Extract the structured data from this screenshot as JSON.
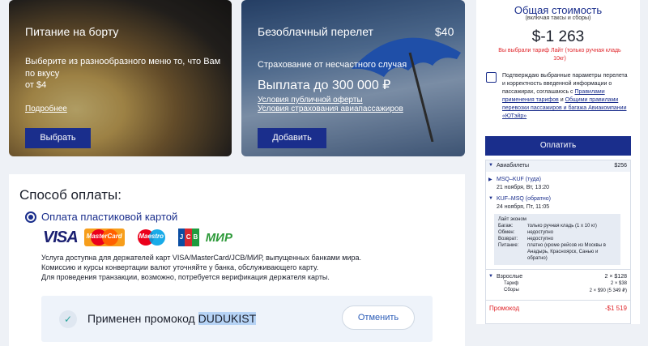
{
  "food_card": {
    "title": "Питание на борту",
    "text": "Выберите из разнообразного меню то, что Вам по вкусу",
    "price": "от $4",
    "link": "Подробнее",
    "button": "Выбрать"
  },
  "insurance_card": {
    "title": "Безоблачный перелет",
    "price": "$40",
    "subtitle": "Страхование от несчастного случая",
    "payout": "Выплата до 300 000 ₽",
    "link1": "Условия публичной оферты",
    "link2": "Условия страхования авиапассажиров",
    "button": "Добавить"
  },
  "payment": {
    "title": "Способ оплаты:",
    "option_label": "Оплата пластиковой картой",
    "card_brands": [
      "VISA",
      "MasterCard",
      "Maestro",
      "JCB",
      "МИР"
    ],
    "desc_line1": "Услуга доступна для держателей карт VISA/MasterCard/JCB/МИР, выпущенных банками мира.",
    "desc_line2": "Комиссию и курсы конвертации валют уточняйте у банка, обслуживающего карту.",
    "desc_line3": "Для проведения транзакции, возможно, потребуется верификация держателя карты.",
    "promo_prefix": "Применен промокод",
    "promo_code": "DUDUKIST",
    "cancel_button": "Отменить"
  },
  "summary": {
    "title": "Общая стоимость",
    "subtitle": "(включая таксы и сборы)",
    "total": "$-1 263",
    "note": "Вы выбрали тариф Лайт (только ручная кладь 10кг)",
    "agree_text_1": "Подтверждаю выбранные параметры перелета и корректность введенной информации о пассажирах, соглашаюсь с",
    "agree_link_1": "Правилами применения тарифов",
    "agree_text_2": "и",
    "agree_link_2": "Общими правилами перевозки пассажиров и багажа Авиакомпании «ЮТэйр»",
    "pay_button": "Оплатить",
    "tickets_label": "Авиабилеты",
    "tickets_price": "$256",
    "flight1_route": "MSQ–KUF (туда)",
    "flight1_date": "21 ноября, Вт, 13:20",
    "flight2_route": "KUF–MSQ (обратно)",
    "flight2_date": "24 ноября, Пт, 11:05",
    "fare_name": "Лайт эконом",
    "baggage_label": "Багаж:",
    "baggage_value": "только ручная кладь (1 х 10 кг)",
    "exchange_label": "Обмен:",
    "exchange_value": "недоступно",
    "refund_label": "Возврат:",
    "refund_value": "недоступно",
    "meal_label": "Питание:",
    "meal_value": "платно (кроме рейсов из Москвы в Анадырь, Красноярск, Санью и обратно)",
    "adults_label": "Взрослые",
    "adults_value": "2 × $128",
    "tariff_label": "Тариф",
    "tariff_value": "2 × $38",
    "fees_label": "Сборы",
    "fees_value": "2 × $90 (5 349 ₽)",
    "promo_label": "Промокод",
    "promo_value": "-$1 519"
  },
  "colors": {
    "brand_blue": "#1a2e8c",
    "discount_red": "#e0262b",
    "check_teal": "#2aa59c"
  }
}
